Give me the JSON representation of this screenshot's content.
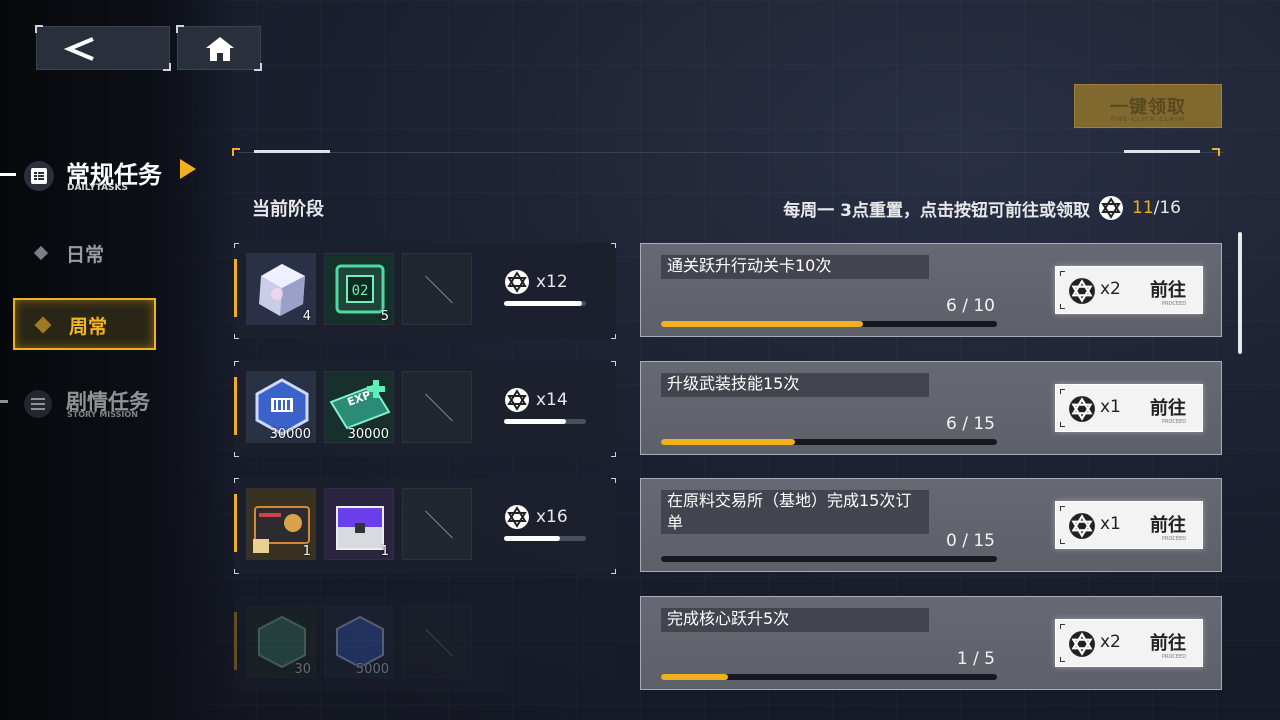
{
  "nav": {
    "back_icon": "back-arrow-icon",
    "home_icon": "home-icon",
    "claim_all": "一键领取",
    "claim_all_sub": "ONE-CLICK CLAIM",
    "main": {
      "title": "常规任务",
      "sub": "DAILYTASKS"
    },
    "daily": "日常",
    "weekly": "周常",
    "story": {
      "title": "剧情任务",
      "sub": "STORY MISSION"
    }
  },
  "header": {
    "stage": "当前阶段",
    "reset": "每周一 3点重置，点击按钮可前往或领取",
    "progress_current": "11",
    "progress_total": "/16"
  },
  "rewards": [
    {
      "items": [
        {
          "name": "cube-crystal",
          "qty": "4"
        },
        {
          "name": "chip-02",
          "qty": "5"
        },
        {
          "name": "empty",
          "qty": ""
        }
      ],
      "badge": "x12",
      "fill": 0.95
    },
    {
      "items": [
        {
          "name": "credit-cube",
          "qty": "30000"
        },
        {
          "name": "exp-ticket",
          "qty": "30000"
        },
        {
          "name": "empty",
          "qty": ""
        }
      ],
      "badge": "x14",
      "fill": 0.76
    },
    {
      "items": [
        {
          "name": "gift-card",
          "qty": "1"
        },
        {
          "name": "purple-chest",
          "qty": "1"
        },
        {
          "name": "empty",
          "qty": ""
        }
      ],
      "badge": "x16",
      "fill": 0.68
    },
    {
      "items": [
        {
          "name": "green-part",
          "qty": "30"
        },
        {
          "name": "blue-part",
          "qty": "5000"
        },
        {
          "name": "empty",
          "qty": ""
        }
      ],
      "badge": "",
      "fill": 0
    }
  ],
  "tasks": [
    {
      "name": "通关跃升行动关卡10次",
      "count": "6 / 10",
      "fill": 0.6,
      "mult": "x2",
      "go": "前往",
      "go_sub": "PROCEED"
    },
    {
      "name": "升级武装技能15次",
      "count": "6 / 15",
      "fill": 0.4,
      "mult": "x1",
      "go": "前往",
      "go_sub": "PROCEED"
    },
    {
      "name": "在原料交易所（基地）完成15次订单",
      "count": "0 / 15",
      "fill": 0,
      "mult": "x1",
      "go": "前往",
      "go_sub": "PROCEED"
    },
    {
      "name": "完成核心跃升5次",
      "count": "1 / 5",
      "fill": 0.2,
      "mult": "x2",
      "go": "前往",
      "go_sub": "PROCEED"
    }
  ],
  "colors": {
    "accent": "#f0b020",
    "panel": "#1c202c",
    "task_bg": "#62656e"
  }
}
